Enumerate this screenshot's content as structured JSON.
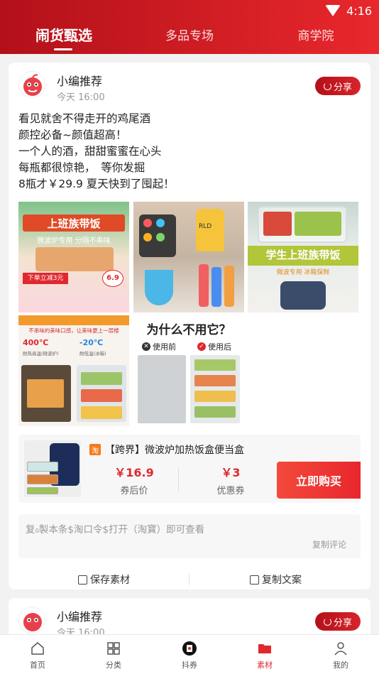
{
  "status": {
    "time": "4:16"
  },
  "tabs": [
    {
      "label": "闹货甄选"
    },
    {
      "label": "多品专场"
    },
    {
      "label": "商学院"
    }
  ],
  "post": {
    "author": "小编推荐",
    "time": "今天 16:00",
    "share_label": "分享",
    "lines": [
      "看见就舍不得走开的鸡尾酒",
      "颜控必备~颜值超高！",
      "一个人的酒，甜甜蜜蜜在心头",
      "每瓶都很惊艳，　等你发掘",
      "8瓶才￥29.9 夏天快到了囤起！"
    ],
    "images": [
      {
        "text": "上班族带饭",
        "sub": "微波炉专用 分隔不串味",
        "tag": "下单立减3元",
        "price": "6.9"
      },
      {
        "text": "RLD"
      },
      {
        "text": "学生上班族带饭",
        "sub": "微波专用 冰箱保鲜"
      },
      {
        "text": "不串味的美味口感，让美味更上一层楼",
        "hot": "400℃",
        "hot_label": "耐热高温(微波炉)",
        "cold": "-20℃",
        "cold_label": "耐低温(冰箱)"
      },
      {
        "text": "为什么不用它？",
        "before": "使用前",
        "after": "使用后"
      }
    ],
    "product": {
      "platform_badge": "淘",
      "title": "【跨界】微波炉加热饭盒便当盒",
      "price": "￥16.9",
      "price_label": "券后价",
      "coupon": "￥3",
      "coupon_label": "优惠券",
      "buy_label": "立即购买"
    },
    "copy_text": "复₀製本条$淘口令$打开（淘寳）即可查看",
    "copy_comment": "复制评论",
    "save_label": "保存素材",
    "copy_label": "复制文案"
  },
  "post2": {
    "author": "小编推荐",
    "time": "今天 16:00",
    "share_label": "分享"
  },
  "nav": [
    {
      "label": "首页",
      "icon": "home-icon"
    },
    {
      "label": "分类",
      "icon": "category-icon"
    },
    {
      "label": "抖券",
      "icon": "douyin-icon"
    },
    {
      "label": "素材",
      "icon": "folder-icon",
      "active": true
    },
    {
      "label": "我的",
      "icon": "user-icon"
    }
  ],
  "colors": {
    "brand": "#d9242b",
    "price": "#e0282e"
  }
}
